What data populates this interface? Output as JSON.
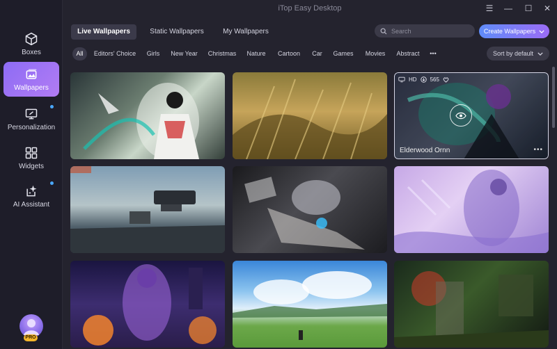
{
  "app": {
    "title": "iTop Easy Desktop"
  },
  "window": {
    "minimize": "—",
    "maximize": "☐",
    "close": "✕",
    "menu": "☰"
  },
  "sidebar": {
    "items": [
      {
        "label": "Boxes",
        "icon": "box-icon"
      },
      {
        "label": "Wallpapers",
        "icon": "image-icon",
        "active": true
      },
      {
        "label": "Personalization",
        "icon": "monitor-icon"
      },
      {
        "label": "Widgets",
        "icon": "widgets-icon"
      },
      {
        "label": "AI Assistant",
        "icon": "ai-icon"
      }
    ],
    "badge": "PRO"
  },
  "tabs": [
    {
      "label": "Live Wallpapers",
      "active": true
    },
    {
      "label": "Static Wallpapers"
    },
    {
      "label": "My Wallpapers"
    }
  ],
  "search": {
    "placeholder": "Search"
  },
  "create_button": {
    "label": "Create Wallpapers"
  },
  "categories": [
    "All",
    "Editors' Choice",
    "Girls",
    "New Year",
    "Christmas",
    "Nature",
    "Cartoon",
    "Car",
    "Games",
    "Movies",
    "Abstract"
  ],
  "more_categories": "•••",
  "sort": {
    "label": "Sort by default"
  },
  "hover_card": {
    "quality": "HD",
    "downloads": "565",
    "name": "Elderwood Ornn",
    "more": "•••"
  },
  "colors": {
    "accent": "#9b6cf5",
    "background": "#24232e",
    "sidebar": "#1e1d29"
  }
}
